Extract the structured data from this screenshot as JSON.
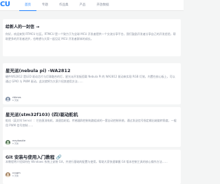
{
  "brand": {
    "logo_text": "CU",
    "accent": "#1e80ff"
  },
  "nav": [
    {
      "label": "首页",
      "active": true
    },
    {
      "label": "专题",
      "active": false
    },
    {
      "label": "作品集",
      "active": false
    },
    {
      "label": "产品",
      "active": false
    },
    {
      "label": "开放数据",
      "active": false
    }
  ],
  "cards": [
    {
      "title": "给新人的一封信 →",
      "desc": "你好，欢迎来到 RTMCU 社区。RTMCU 是一个致力于为全球 MCU 开发者提供一个交流分享平台，我们鼓励开发者分享自己的开发经验，帮助更多的开发者进步，也希望与大家一起见证 MCU 开发者群体的成长。"
    },
    {
      "title": "星光派(nebula pi) -WA2812",
      "desc": "硬件WS2812 是LED 驱动芯片与灯珠融合的灯，星光派开发板搭载 Nebula Pi 的 WA2812 驱动来实现 RGB 灯效，内置在核心板上，可以通过 GPIO 与 PWM 驱动，此次就将为大家介绍其使用方法……",
      "author": "rttimes",
      "time": "6 天前"
    },
    {
      "title": "星光派(stm32f103) (四)驱动舵机",
      "desc": "舵机（英文叫 Servo）：它由直流电机、减速齿轮组、传感器和控制电路组成的一套自动控制系统，通过发送信号指定输出轴旋转角度，一般用 PWM 信号控制……",
      "author": "meybaskle",
      "time": "6 天前"
    },
    {
      "title": "Git 安装与使用入门教程 🔗",
      "desc": "本教程将介绍如何在 Windows 系统上安装 Git，并进行基础的配置与使用，帮助大家快速掌握 Git 版本控制工具的核心操作方法……",
      "author": "ccugm",
      "time": "6 天前"
    }
  ]
}
